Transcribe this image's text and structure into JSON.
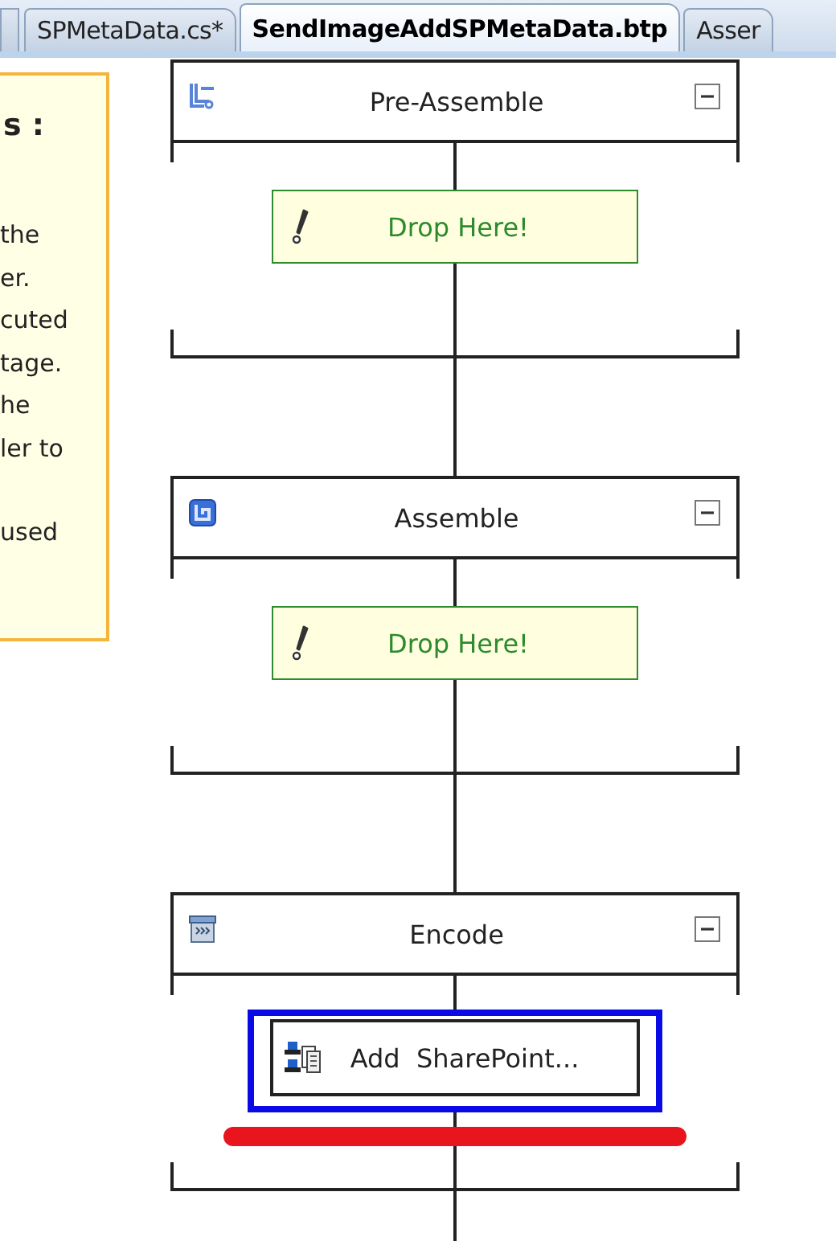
{
  "tabs": [
    {
      "label": "SPMetaData.cs*",
      "selected": false
    },
    {
      "label": "SendImageAddSPMetaData.btp",
      "selected": true
    },
    {
      "label": "Asser",
      "selected": false
    }
  ],
  "info_panel": {
    "heading": "s :",
    "paragraphs": [
      [
        "the",
        "er.",
        "cuted",
        "tage.",
        "he",
        "ler to"
      ],
      [
        "used"
      ]
    ]
  },
  "stages": [
    {
      "name": "Pre-Assemble",
      "expanded": true,
      "items": [
        {
          "kind": "drop-target",
          "label": "Drop Here!"
        }
      ]
    },
    {
      "name": "Assemble",
      "expanded": true,
      "items": [
        {
          "kind": "drop-target",
          "label": "Drop Here!"
        }
      ]
    },
    {
      "name": "Encode",
      "expanded": true,
      "items": [
        {
          "kind": "component",
          "label": "Add  SharePoint...",
          "highlighted": true
        }
      ]
    }
  ]
}
